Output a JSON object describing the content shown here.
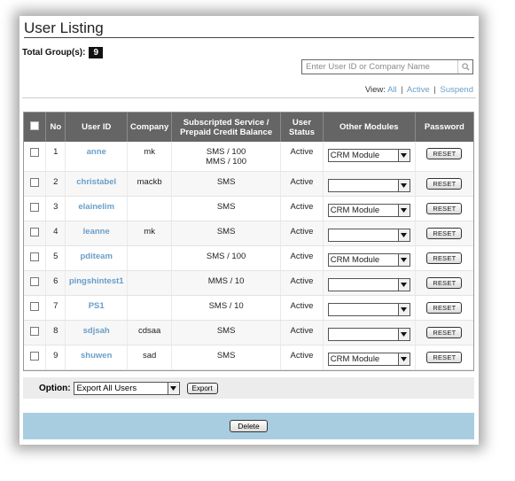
{
  "page": {
    "title": "User Listing",
    "total_label": "Total Group(s):",
    "total_count": "9"
  },
  "search": {
    "placeholder": "Enter User ID or Company Name",
    "icon": "search-icon"
  },
  "view": {
    "label": "View:",
    "all": "All",
    "active": "Active",
    "suspend": "Suspend",
    "sep": "|"
  },
  "table": {
    "headers": {
      "no": "No",
      "user_id": "User ID",
      "company": "Company",
      "service_line1": "Subscripted Service /",
      "service_line2": "Prepaid Credit Balance",
      "status_line1": "User",
      "status_line2": "Status",
      "other_modules": "Other Modules",
      "password": "Password"
    },
    "rows": [
      {
        "no": "1",
        "user_id": "anne",
        "company": "mk",
        "service": "SMS / 100",
        "service2": "MMS / 100",
        "status": "Active",
        "module": "CRM Module",
        "reset": "RESET"
      },
      {
        "no": "2",
        "user_id": "christabel",
        "company": "mackb",
        "service": "SMS",
        "service2": "",
        "status": "Active",
        "module": "",
        "reset": "RESET"
      },
      {
        "no": "3",
        "user_id": "elainelim",
        "company": "",
        "service": "SMS",
        "service2": "",
        "status": "Active",
        "module": "CRM Module",
        "reset": "RESET"
      },
      {
        "no": "4",
        "user_id": "leanne",
        "company": "mk",
        "service": "SMS",
        "service2": "",
        "status": "Active",
        "module": "",
        "reset": "RESET"
      },
      {
        "no": "5",
        "user_id": "pditeam",
        "company": "",
        "service": "SMS / 100",
        "service2": "",
        "status": "Active",
        "module": "CRM Module",
        "reset": "RESET"
      },
      {
        "no": "6",
        "user_id": "pingshintest1",
        "company": "",
        "service": "MMS / 10",
        "service2": "",
        "status": "Active",
        "module": "",
        "reset": "RESET"
      },
      {
        "no": "7",
        "user_id": "PS1",
        "company": "",
        "service": "SMS / 10",
        "service2": "",
        "status": "Active",
        "module": "",
        "reset": "RESET"
      },
      {
        "no": "8",
        "user_id": "sdjsah",
        "company": "cdsaa",
        "service": "SMS",
        "service2": "",
        "status": "Active",
        "module": "",
        "reset": "RESET"
      },
      {
        "no": "9",
        "user_id": "shuwen",
        "company": "sad",
        "service": "SMS",
        "service2": "",
        "status": "Active",
        "module": "CRM Module",
        "reset": "RESET"
      }
    ]
  },
  "option": {
    "label": "Option:",
    "selected": "Export All Users",
    "export_button": "Export"
  },
  "footer": {
    "delete_button": "Delete"
  },
  "colors": {
    "header_bg": "#656565",
    "link": "#6a9ec8",
    "footer_bg": "#a9cde0"
  }
}
